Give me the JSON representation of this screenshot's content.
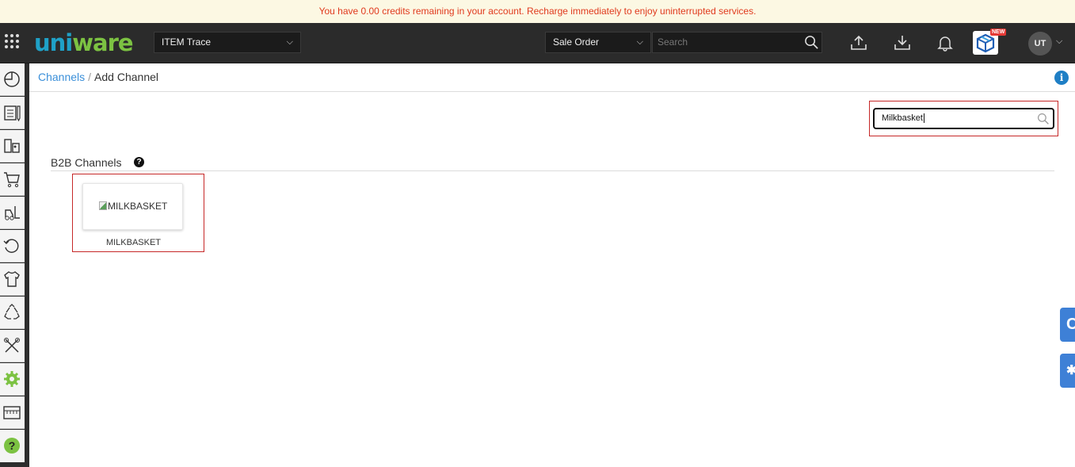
{
  "banner": {
    "text": "You have 0.00 credits remaining in your account. Recharge immediately to enjoy uninterrupted services."
  },
  "header": {
    "logo_part1": "uni",
    "logo_part2": "ware",
    "module_select": "ITEM Trace",
    "search_type": "Sale Order",
    "search_placeholder": "Search",
    "new_badge": "NEW",
    "avatar_initials": "UT"
  },
  "sidebar": {
    "items": [
      {
        "icon": "dashboard-icon"
      },
      {
        "icon": "orders-icon"
      },
      {
        "icon": "shipping-icon"
      },
      {
        "icon": "cart-icon"
      },
      {
        "icon": "forklift-icon"
      },
      {
        "icon": "returns-icon"
      },
      {
        "icon": "products-icon"
      },
      {
        "icon": "recycle-icon"
      },
      {
        "icon": "tools-icon"
      },
      {
        "icon": "settings-icon"
      },
      {
        "icon": "reports-icon"
      },
      {
        "icon": "help-icon"
      }
    ],
    "active_accent": "#7cc242"
  },
  "breadcrumb": {
    "link": "Channels",
    "separator": "/",
    "current": "Add Channel"
  },
  "channel_search": {
    "value": "Milkbasket"
  },
  "section": {
    "title": "B2B Channels"
  },
  "channels": [
    {
      "image_alt": "MILKBASKET",
      "label": "MILKBASKET"
    }
  ],
  "side_tabs": [
    {
      "glyph": "C"
    },
    {
      "glyph": "✱"
    }
  ],
  "colors": {
    "banner_text": "#e03a1e",
    "highlight": "#c62828",
    "link": "#3a8fd9",
    "brand_blue": "#1fa1c7"
  }
}
